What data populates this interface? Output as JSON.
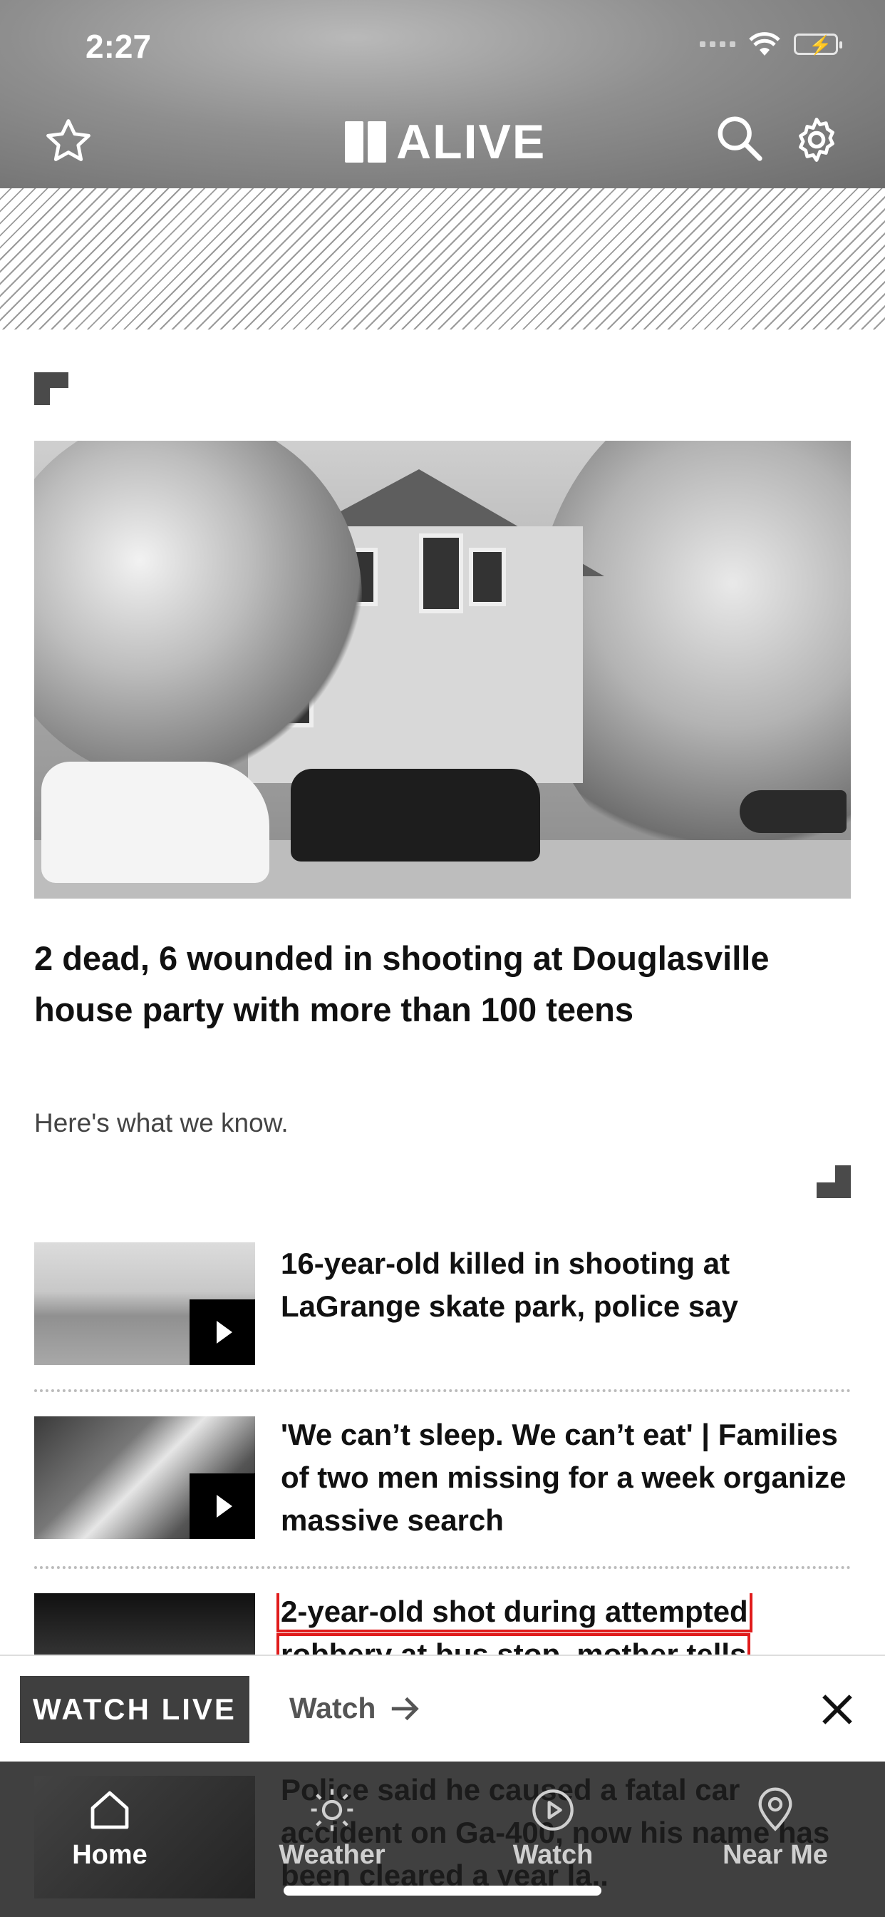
{
  "status": {
    "time": "2:27"
  },
  "header": {
    "logo_text": "ALIVE"
  },
  "hero": {
    "title": "2 dead, 6 wounded in shooting at Douglasville house party with more than 100 teens",
    "subtitle": "Here's what we know."
  },
  "stories": [
    {
      "title": "16-year-old killed in shooting at LaGrange skate park, police say"
    },
    {
      "title": "'We can’t sleep. We can’t eat' | Families of two men missing for a week organize massive search"
    },
    {
      "title": "2-year-old shot during attempted robbery at bus stop, mother tells"
    },
    {
      "title": "Police said he caused a fatal car accident on Ga-400, now his name has been cleared a year la.."
    }
  ],
  "watch_bar": {
    "live_label": "WATCH LIVE",
    "watch_label": "Watch"
  },
  "nav": {
    "items": [
      {
        "label": "Home",
        "icon": "home-icon"
      },
      {
        "label": "Weather",
        "icon": "sun-icon"
      },
      {
        "label": "Watch",
        "icon": "play-circle-icon"
      },
      {
        "label": "Near Me",
        "icon": "location-pin-icon"
      }
    ]
  },
  "colors": {
    "highlight": "#e01b1b",
    "watch_live_bg": "#3f3f3f"
  }
}
